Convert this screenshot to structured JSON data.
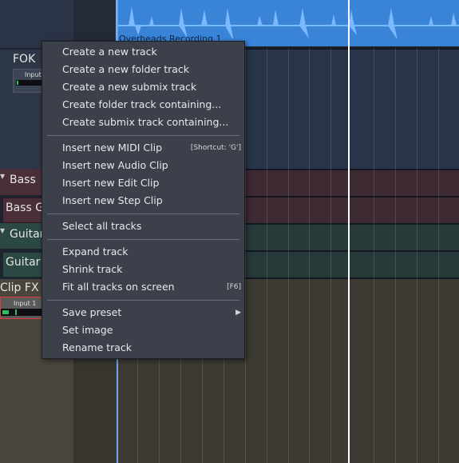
{
  "clip": {
    "name": "Overheads Recording 1",
    "color": "#3a84d8"
  },
  "tracks": [
    {
      "name": "FOK",
      "input_label": "Input",
      "color": "#28344a"
    },
    {
      "name": "Bass",
      "color": "#3d2a33"
    },
    {
      "name": "Bass Gu",
      "color": "#3d2a33"
    },
    {
      "name": "Guitar",
      "color": "#263a3a"
    },
    {
      "name": "Guitar",
      "color": "#263a3a"
    },
    {
      "name": "Clip FX",
      "input_label": "Input 1",
      "color": "#3d3a33"
    }
  ],
  "menu": {
    "items": [
      {
        "label": "Create a new track"
      },
      {
        "label": "Create a new folder track"
      },
      {
        "label": "Create a new submix track"
      },
      {
        "label": "Create folder track containing..."
      },
      {
        "label": "Create submix track containing..."
      },
      {
        "label": "Insert new MIDI Clip",
        "shortcut": "[Shortcut: 'G']"
      },
      {
        "label": "Insert new Audio Clip"
      },
      {
        "label": "Insert new Edit Clip"
      },
      {
        "label": "Insert new Step Clip"
      },
      {
        "label": "Select all tracks"
      },
      {
        "label": "Expand track"
      },
      {
        "label": "Shrink track"
      },
      {
        "label": "Fit all tracks on screen",
        "shortcut": "[F6]"
      },
      {
        "label": "Save preset",
        "submenu": true
      },
      {
        "label": "Set image"
      },
      {
        "label": "Rename track"
      }
    ]
  }
}
